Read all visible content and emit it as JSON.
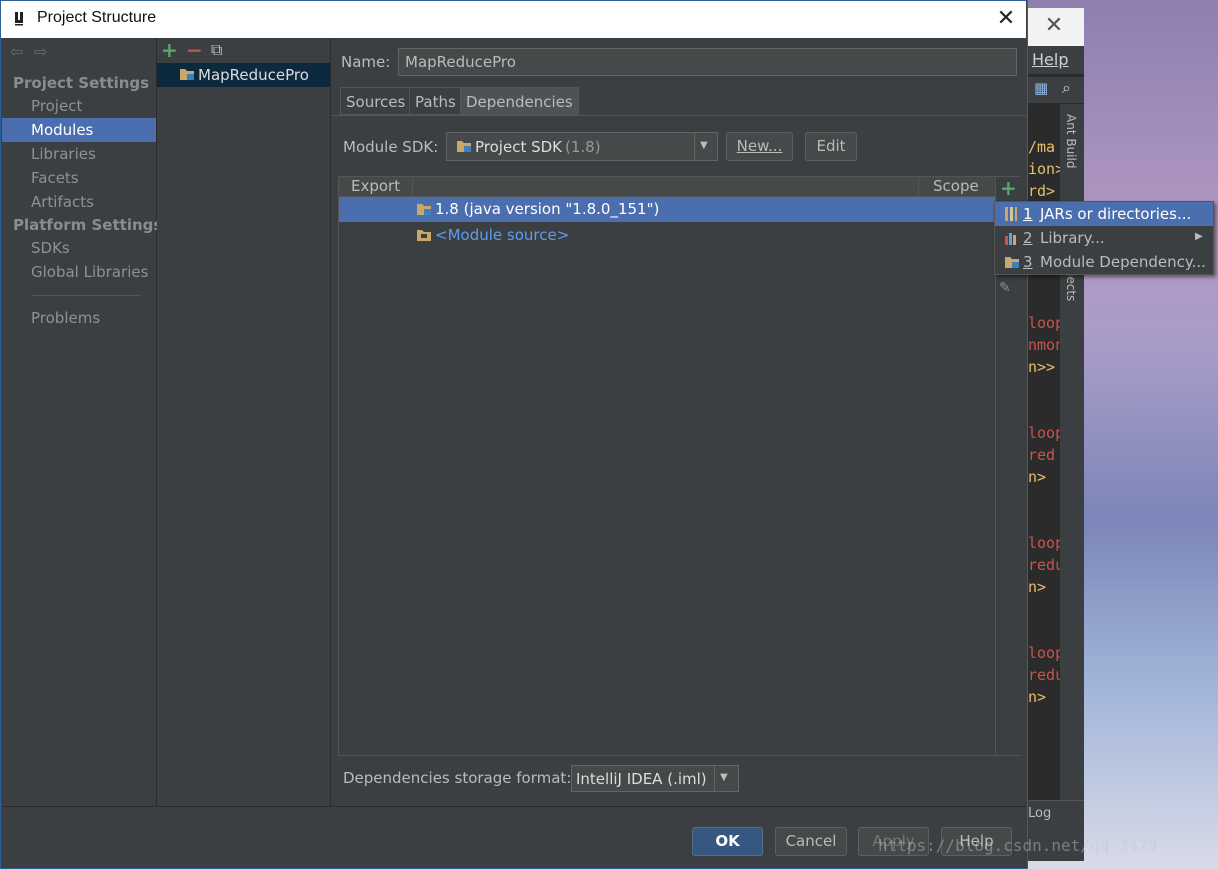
{
  "background_ide": {
    "help_menu": "Help",
    "side_tabs": [
      "Ant Build",
      "Projects"
    ],
    "status_log": "Log",
    "code_fragments": [
      "/ma",
      "ion>",
      "rd>",
      "loop",
      "nmon",
      "n>>",
      "loop",
      "red",
      "n>",
      "loop",
      "redu",
      "n>",
      "loop",
      "redu",
      "n>"
    ]
  },
  "dialog": {
    "title": "Project Structure",
    "close_glyph": "✕"
  },
  "left_nav": {
    "back_glyph": "⇦",
    "forward_glyph": "⇨",
    "project_settings_header": "Project Settings",
    "project_settings": [
      "Project",
      "Modules",
      "Libraries",
      "Facets",
      "Artifacts"
    ],
    "platform_settings_header": "Platform Settings",
    "platform_settings": [
      "SDKs",
      "Global Libraries"
    ],
    "problems": "Problems",
    "selected": "Modules"
  },
  "modules_panel": {
    "add_glyph": "+",
    "remove_glyph": "−",
    "copy_glyph": "⧉",
    "modules": [
      "MapReducePro"
    ]
  },
  "module_detail": {
    "name_label": "Name:",
    "name_value": "MapReducePro",
    "tabs": [
      "Sources",
      "Paths",
      "Dependencies"
    ],
    "active_tab": "Dependencies",
    "sdk_label": "Module SDK:",
    "sdk_value": "Project SDK",
    "sdk_version": "(1.8)",
    "new_button": "New...",
    "edit_button": "Edit",
    "table_headers": {
      "export": "Export",
      "scope": "Scope"
    },
    "dependencies": [
      {
        "label": "1.8 (java version \"1.8.0_151\")",
        "selected": true
      },
      {
        "label": "<Module source>",
        "selected": false
      }
    ],
    "storage_label": "Dependencies storage format:",
    "storage_value": "IntelliJ IDEA (.iml)"
  },
  "add_menu": {
    "items": [
      {
        "num": "1",
        "label": "JARs or directories...",
        "selected": true
      },
      {
        "num": "2",
        "label": "Library...",
        "submenu": true
      },
      {
        "num": "3",
        "label": "Module Dependency..."
      }
    ]
  },
  "footer": {
    "ok": "OK",
    "cancel": "Cancel",
    "apply": "Apply",
    "help": "Help",
    "watermark": "https://blog.csdn.net/qq_3479"
  },
  "colors": {
    "selection": "#4b6eaf",
    "panel_bg": "#3c3f41",
    "link_blue": "#589df6"
  }
}
